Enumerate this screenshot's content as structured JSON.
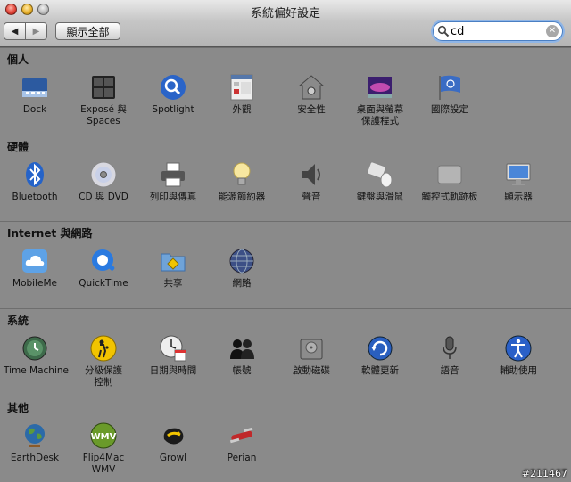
{
  "window": {
    "title": "系統偏好設定"
  },
  "toolbar": {
    "back": "◀",
    "forward": "▶",
    "show_all": "顯示全部"
  },
  "search": {
    "value": "cd",
    "clear": "✕"
  },
  "sections": [
    {
      "title": "個人",
      "items": [
        {
          "label": "Dock",
          "icon": "dock-icon"
        },
        {
          "label": "Exposé 與",
          "label2": "Spaces",
          "icon": "expose-icon"
        },
        {
          "label": "Spotlight",
          "icon": "spotlight-icon"
        },
        {
          "label": "外觀",
          "icon": "appearance-icon"
        },
        {
          "label": "安全性",
          "icon": "security-house-icon"
        },
        {
          "label": "桌面與螢幕",
          "label2": "保護程式",
          "icon": "desktop-screensaver-icon"
        },
        {
          "label": "國際設定",
          "icon": "international-flag-icon"
        }
      ]
    },
    {
      "title": "硬體",
      "items": [
        {
          "label": "Bluetooth",
          "icon": "bluetooth-icon"
        },
        {
          "label": "CD 與 DVD",
          "icon": "cd-dvd-icon"
        },
        {
          "label": "列印與傳真",
          "icon": "printer-icon"
        },
        {
          "label": "能源節約器",
          "icon": "lightbulb-icon"
        },
        {
          "label": "聲音",
          "icon": "speaker-icon"
        },
        {
          "label": "鍵盤與滑鼠",
          "icon": "keyboard-mouse-icon"
        },
        {
          "label": "觸控式軌跡板",
          "icon": "trackpad-icon"
        },
        {
          "label": "顯示器",
          "icon": "display-icon"
        }
      ]
    },
    {
      "title": "Internet 與網路",
      "items": [
        {
          "label": "MobileMe",
          "icon": "mobileme-cloud-icon"
        },
        {
          "label": "QuickTime",
          "icon": "quicktime-icon"
        },
        {
          "label": "共享",
          "icon": "sharing-folder-icon"
        },
        {
          "label": "網路",
          "icon": "network-globe-icon"
        }
      ]
    },
    {
      "title": "系統",
      "items": [
        {
          "label": "Time Machine",
          "icon": "time-machine-icon"
        },
        {
          "label": "分級保護",
          "label2": "控制",
          "icon": "parental-controls-icon"
        },
        {
          "label": "日期與時間",
          "icon": "date-time-icon"
        },
        {
          "label": "帳號",
          "icon": "accounts-icon"
        },
        {
          "label": "啟動磁碟",
          "icon": "startup-disk-icon"
        },
        {
          "label": "軟體更新",
          "icon": "software-update-icon"
        },
        {
          "label": "語音",
          "icon": "microphone-icon"
        },
        {
          "label": "輔助使用",
          "icon": "accessibility-icon"
        }
      ]
    },
    {
      "title": "其他",
      "items": [
        {
          "label": "EarthDesk",
          "icon": "earthdesk-icon"
        },
        {
          "label": "Flip4Mac",
          "label2": "WMV",
          "icon": "flip4mac-icon",
          "badge": "WMV"
        },
        {
          "label": "Growl",
          "icon": "growl-icon"
        },
        {
          "label": "Perian",
          "icon": "perian-icon"
        }
      ]
    }
  ],
  "watermark": "#211467"
}
